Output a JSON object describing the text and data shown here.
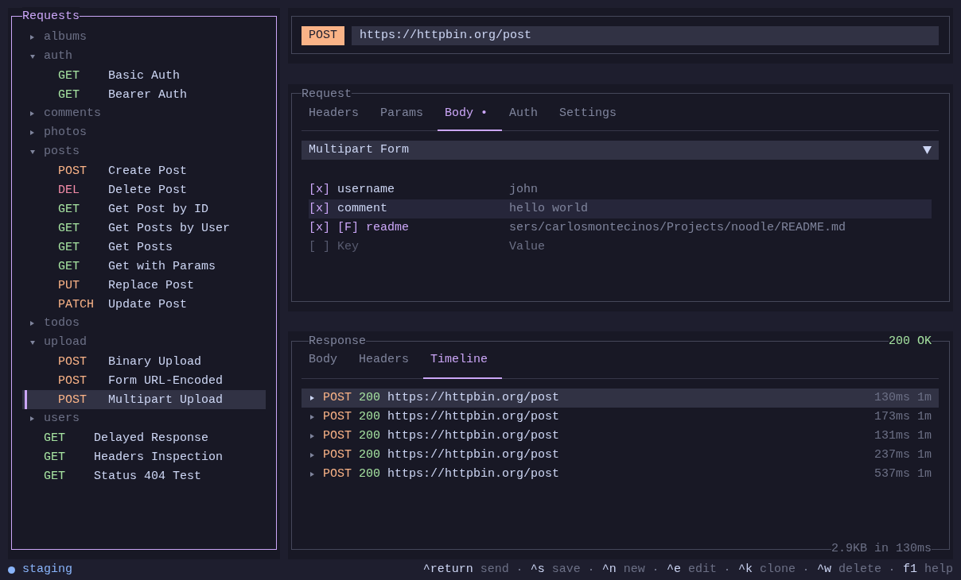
{
  "sidebar": {
    "title": "Requests",
    "focused": true,
    "tree": [
      {
        "kind": "folder",
        "name": "albums",
        "expanded": false
      },
      {
        "kind": "folder",
        "name": "auth",
        "expanded": true,
        "children": [
          {
            "kind": "request",
            "method": "GET",
            "color": "#a6e3a1",
            "name": "Basic Auth",
            "selected": false
          },
          {
            "kind": "request",
            "method": "GET",
            "color": "#a6e3a1",
            "name": "Bearer Auth",
            "selected": false
          }
        ]
      },
      {
        "kind": "folder",
        "name": "comments",
        "expanded": false
      },
      {
        "kind": "folder",
        "name": "photos",
        "expanded": false
      },
      {
        "kind": "folder",
        "name": "posts",
        "expanded": true,
        "children": [
          {
            "kind": "request",
            "method": "POST",
            "color": "#fab387",
            "name": "Create Post",
            "selected": false
          },
          {
            "kind": "request",
            "method": "DEL",
            "color": "#f38ba8",
            "name": "Delete Post",
            "selected": false
          },
          {
            "kind": "request",
            "method": "GET",
            "color": "#a6e3a1",
            "name": "Get Post by ID",
            "selected": false
          },
          {
            "kind": "request",
            "method": "GET",
            "color": "#a6e3a1",
            "name": "Get Posts by User",
            "selected": false
          },
          {
            "kind": "request",
            "method": "GET",
            "color": "#a6e3a1",
            "name": "Get Posts",
            "selected": false
          },
          {
            "kind": "request",
            "method": "GET",
            "color": "#a6e3a1",
            "name": "Get with Params",
            "selected": false
          },
          {
            "kind": "request",
            "method": "PUT",
            "color": "#fab387",
            "name": "Replace Post",
            "selected": false
          },
          {
            "kind": "request",
            "method": "PATCH",
            "color": "#fab387",
            "name": "Update Post",
            "selected": false
          }
        ]
      },
      {
        "kind": "folder",
        "name": "todos",
        "expanded": false
      },
      {
        "kind": "folder",
        "name": "upload",
        "expanded": true,
        "children": [
          {
            "kind": "request",
            "method": "POST",
            "color": "#fab387",
            "name": "Binary Upload",
            "selected": false
          },
          {
            "kind": "request",
            "method": "POST",
            "color": "#fab387",
            "name": "Form URL-Encoded",
            "selected": false
          },
          {
            "kind": "request",
            "method": "POST",
            "color": "#fab387",
            "name": "Multipart Upload",
            "selected": true
          }
        ]
      },
      {
        "kind": "folder",
        "name": "users",
        "expanded": false
      },
      {
        "kind": "request",
        "method": "GET",
        "color": "#a6e3a1",
        "name": "Delayed Response",
        "selected": false
      },
      {
        "kind": "request",
        "method": "GET",
        "color": "#a6e3a1",
        "name": "Headers Inspection",
        "selected": false
      },
      {
        "kind": "request",
        "method": "GET",
        "color": "#a6e3a1",
        "name": "Status 404 Test",
        "selected": false
      }
    ]
  },
  "url_bar": {
    "method": "POST",
    "url": "https://httpbin.org/post"
  },
  "request_panel": {
    "title": "Request",
    "focused": false,
    "tabs": [
      {
        "label": "Headers",
        "selected": false
      },
      {
        "label": "Params",
        "selected": false
      },
      {
        "label": "Body •",
        "selected": true
      },
      {
        "label": "Auth",
        "selected": false
      },
      {
        "label": "Settings",
        "selected": false
      }
    ],
    "body_type": "Multipart Form",
    "form_fields": [
      {
        "kind": "text",
        "checkbox": "[x]",
        "checked": true,
        "key": "username",
        "value": "john",
        "selected": false
      },
      {
        "kind": "text",
        "checkbox": "[x]",
        "checked": true,
        "key": "comment",
        "value": "hello world",
        "selected": true
      },
      {
        "kind": "file",
        "checkbox": "[x]",
        "checked": true,
        "file_tag": "[F]",
        "key": "readme",
        "value": "sers/carlosmontecinos/Projects/noodle/README.md",
        "selected": false
      }
    ],
    "new_field": {
      "checkbox": "[ ]",
      "checked": false,
      "key_input": {
        "placeholder": "Key"
      },
      "value_input": {
        "placeholder": "Value"
      }
    }
  },
  "response_panel": {
    "title": "Response",
    "focused": false,
    "status": "200 OK",
    "tabs": [
      {
        "label": "Body",
        "selected": false
      },
      {
        "label": "Headers",
        "selected": false
      },
      {
        "label": "Timeline",
        "selected": true
      }
    ],
    "timeline": [
      {
        "method": "POST",
        "status": "200",
        "url": "https://httpbin.org/post",
        "duration": "130ms",
        "age": "1m",
        "selected": true
      },
      {
        "method": "POST",
        "status": "200",
        "url": "https://httpbin.org/post",
        "duration": "173ms",
        "age": "1m",
        "selected": false
      },
      {
        "method": "POST",
        "status": "200",
        "url": "https://httpbin.org/post",
        "duration": "131ms",
        "age": "1m",
        "selected": false
      },
      {
        "method": "POST",
        "status": "200",
        "url": "https://httpbin.org/post",
        "duration": "237ms",
        "age": "1m",
        "selected": false
      },
      {
        "method": "POST",
        "status": "200",
        "url": "https://httpbin.org/post",
        "duration": "537ms",
        "age": "1m",
        "selected": false
      }
    ],
    "summary": "2.9KB in 130ms"
  },
  "status_bar": {
    "environment": "staging",
    "hints": [
      {
        "key": "^return",
        "label": "send"
      },
      {
        "key": "^s",
        "label": "save"
      },
      {
        "key": "^n",
        "label": "new"
      },
      {
        "key": "^e",
        "label": "edit"
      },
      {
        "key": "^k",
        "label": "clone"
      },
      {
        "key": "^w",
        "label": "delete"
      },
      {
        "key": "f1",
        "label": "help"
      }
    ]
  }
}
